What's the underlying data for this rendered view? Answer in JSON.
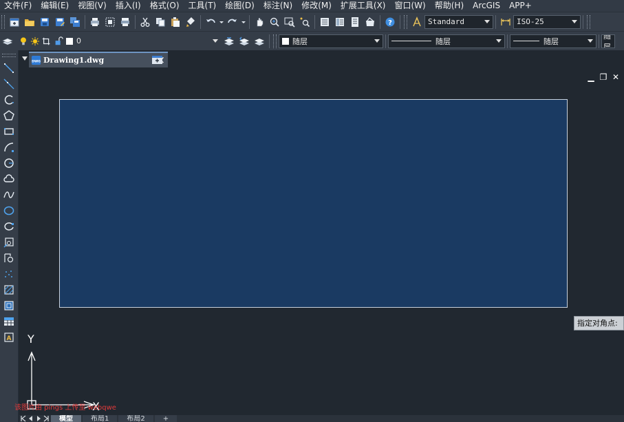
{
  "menu": [
    "文件(F)",
    "编辑(E)",
    "视图(V)",
    "插入(I)",
    "格式(O)",
    "工具(T)",
    "绘图(D)",
    "标注(N)",
    "修改(M)",
    "扩展工具(X)",
    "窗口(W)",
    "帮助(H)",
    "ArcGIS",
    "APP+"
  ],
  "toolbar": {
    "text_style": "Standard",
    "dim_style": "ISO-25",
    "layer_name": "0",
    "color": "随层",
    "linetype": "随层",
    "lineweight": "随层",
    "plotstyle": "随层"
  },
  "tabs": {
    "document": "Drawing1.dwg",
    "dwg_badge": "DWG",
    "layouts": [
      "模型",
      "布局1",
      "布局2",
      "+"
    ]
  },
  "canvas": {
    "tooltip": "指定对角点:",
    "ucs_y": "Y",
    "ucs_x": "X",
    "watermark": "该图片由 pings 上传至 webqwe",
    "sheet_color": "#1a3a62",
    "background_color": "#212830"
  },
  "icons": {
    "palette": [
      "line-icon",
      "ray-icon",
      "polyline-icon",
      "polygon-icon",
      "rectangle-icon",
      "arc-icon",
      "circle-icon",
      "cloud-icon",
      "spline-icon",
      "ellipse-icon",
      "ellipse-arc-icon",
      "insert-block-icon",
      "make-block-icon",
      "point-icon",
      "hatch-icon",
      "region-icon",
      "table-icon",
      "mtext-icon"
    ]
  }
}
